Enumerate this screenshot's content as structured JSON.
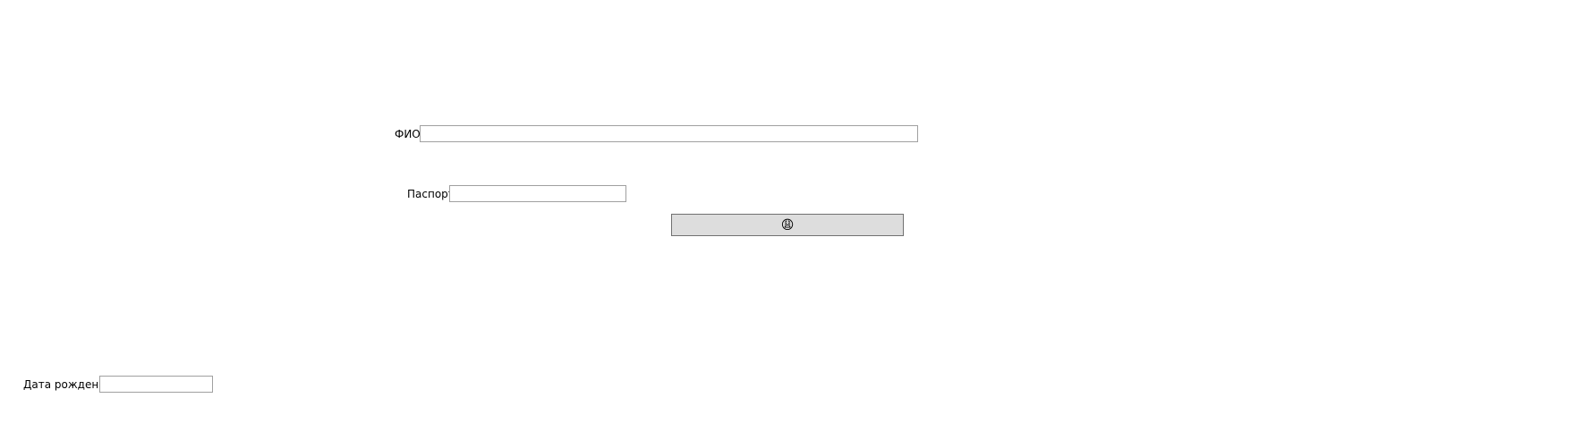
{
  "form": {
    "fio": {
      "label": "ФИО",
      "value": "",
      "placeholder": ""
    },
    "passport": {
      "label": "Паспорт",
      "value": "",
      "placeholder": ""
    },
    "birth_date": {
      "label": "Дата рождения",
      "value": "",
      "placeholder": ""
    },
    "submit_button": {
      "label": "😩",
      "icon": "emoji-face-icon"
    }
  }
}
